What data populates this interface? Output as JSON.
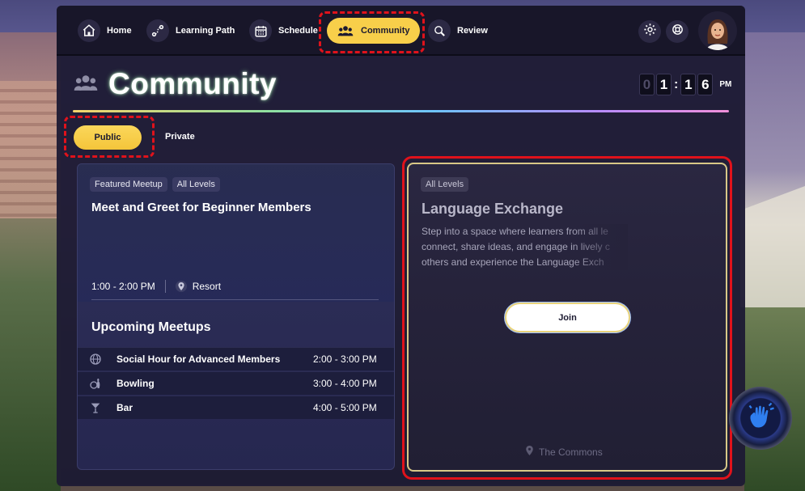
{
  "nav": {
    "items": [
      {
        "label": "Home",
        "icon": "home-icon"
      },
      {
        "label": "Learning Path",
        "icon": "path-icon"
      },
      {
        "label": "Schedule",
        "icon": "calendar-icon"
      },
      {
        "label": "Community",
        "icon": "people-icon",
        "active": true
      },
      {
        "label": "Review",
        "icon": "magnifier-icon"
      }
    ],
    "right_icons": [
      "gear-icon",
      "lifebuoy-icon"
    ],
    "active_color": "#f8cf4a"
  },
  "header": {
    "title": "Community",
    "clock": {
      "digits": [
        "0",
        "1",
        "1",
        "6"
      ],
      "ampm": "PM"
    }
  },
  "tabs": [
    {
      "label": "Public",
      "active": true
    },
    {
      "label": "Private",
      "active": false
    }
  ],
  "featured": {
    "tags": [
      "Featured Meetup",
      "All Levels"
    ],
    "title": "Meet and Greet for Beginner Members",
    "time": "1:00 - 2:00 PM",
    "location": "Resort"
  },
  "upcoming": {
    "title": "Upcoming Meetups",
    "items": [
      {
        "name": "Social Hour for Advanced Members",
        "time": "2:00 - 3:00 PM",
        "icon": "globe-icon"
      },
      {
        "name": "Bowling",
        "time": "3:00 - 4:00 PM",
        "icon": "bowling-icon"
      },
      {
        "name": "Bar",
        "time": "4:00 - 5:00 PM",
        "icon": "cocktail-icon"
      }
    ]
  },
  "event_card": {
    "tag": "All Levels",
    "title": "Language Exchange",
    "description": "Step into a space where learners from all le... connect, share ideas, and engage in lively c... others and experience the Language Exch...",
    "desc_lines": [
      "Step into a space where learners from all le",
      "connect, share ideas, and engage in lively c",
      "others and experience the Language Exch"
    ],
    "join_label": "Join",
    "location": "The Commons"
  },
  "highlight_color": "#e0121b"
}
